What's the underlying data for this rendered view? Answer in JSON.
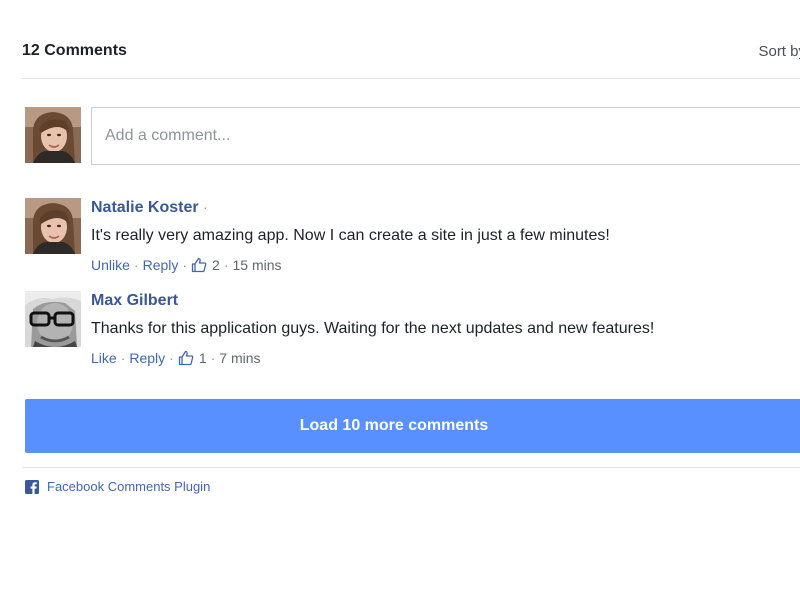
{
  "header": {
    "comment_count": "12 Comments",
    "sort_label": "Sort by"
  },
  "composer": {
    "placeholder": "Add a comment...",
    "avatar_icon": "user-avatar-natalie"
  },
  "comments": [
    {
      "author": "Natalie Koster",
      "separator": "·",
      "text": "It's really very amazing app. Now I can create a site in just a few minutes!",
      "like_label": "Unlike",
      "reply_label": "Reply",
      "likes": "2",
      "time": "15 mins",
      "avatar_icon": "user-avatar-natalie"
    },
    {
      "author": "Max Gilbert",
      "separator": "",
      "text": "Thanks for this application guys. Waiting for the next updates and new features!",
      "like_label": "Like",
      "reply_label": "Reply",
      "likes": "1",
      "time": "7 mins",
      "avatar_icon": "user-avatar-max"
    }
  ],
  "load_more": {
    "label": "Load 10 more comments"
  },
  "footer": {
    "label": "Facebook Comments Plugin",
    "icon": "facebook-icon"
  },
  "colors": {
    "link": "#385898",
    "action_link": "#4267b2",
    "button": "#5890ff",
    "muted": "#90949c"
  }
}
